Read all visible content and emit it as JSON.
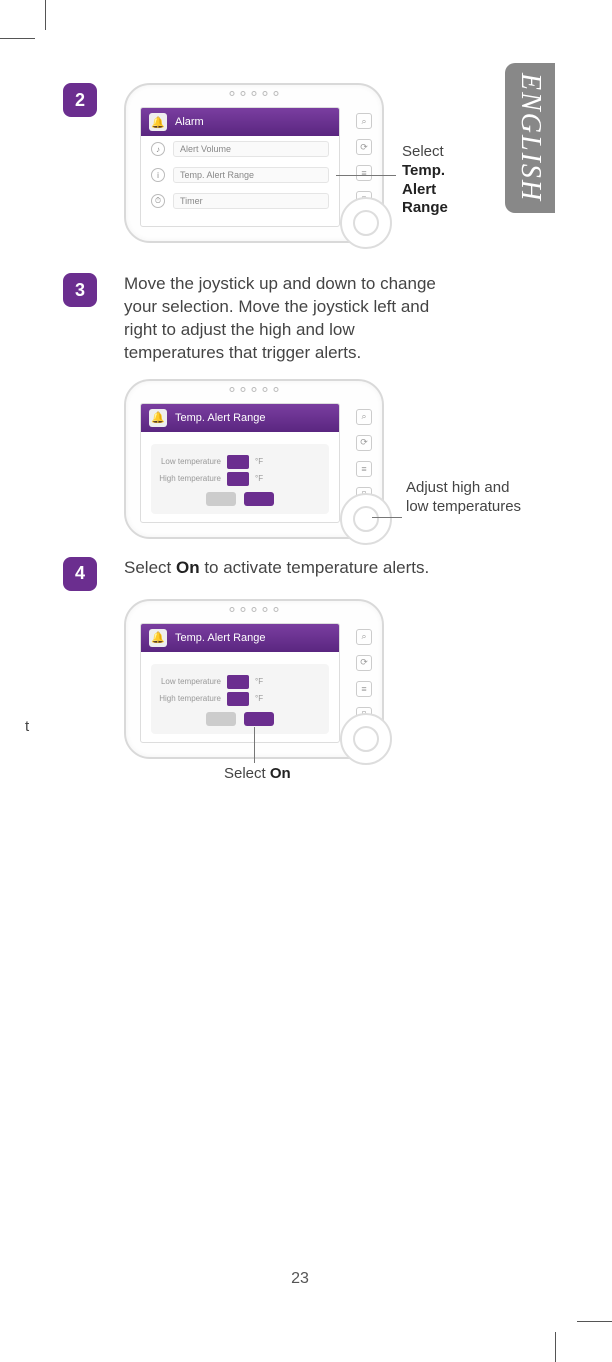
{
  "language_tab": "ENGLISH",
  "steps": {
    "s2": {
      "num": "2"
    },
    "s3": {
      "num": "3",
      "text_a": "Move the joystick up and down to change your selection. Move the joystick left and right to adjust the high and low temperatures that trigger alerts."
    },
    "s4": {
      "num": "4",
      "text_pre": "Select ",
      "text_bold": "On",
      "text_post": " to activate temperature alerts."
    }
  },
  "callout1": {
    "pre": "Select",
    "b1": "Temp.",
    "b2": "Alert",
    "b3": "Range"
  },
  "callout2": "Adjust high and low temperatures",
  "callout3": {
    "pre": "Select ",
    "bold": "On"
  },
  "screen1": {
    "title": "Alarm",
    "items": [
      "Alert Volume",
      "Temp. Alert Range",
      "Timer"
    ]
  },
  "screen2": {
    "title": "Temp. Alert Range",
    "low": "Low temperature",
    "high": "High temperature"
  },
  "page_number": "23",
  "stray": "t"
}
